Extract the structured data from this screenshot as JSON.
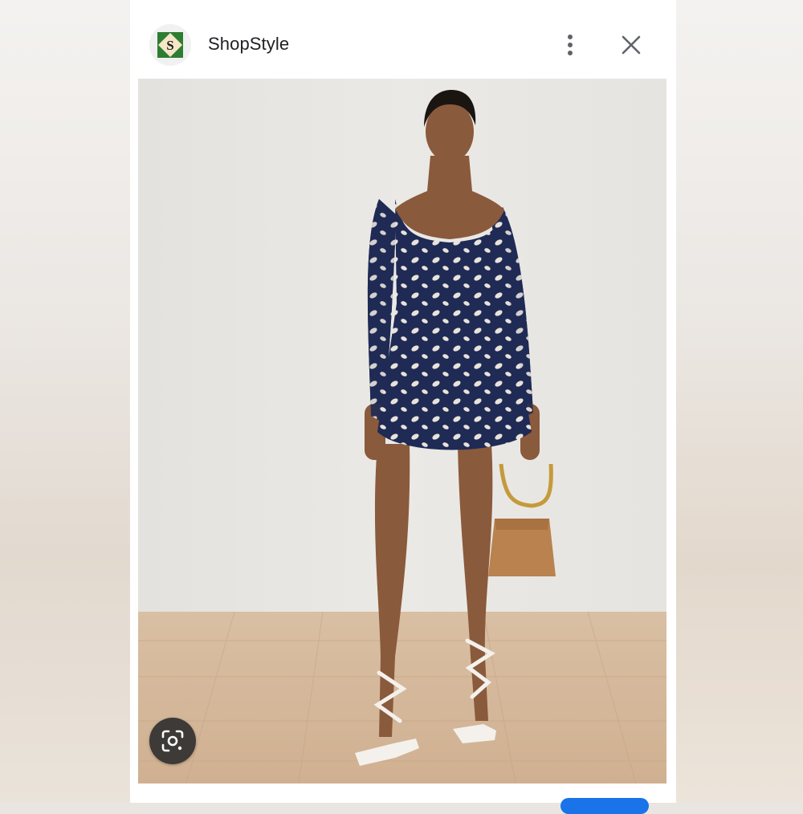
{
  "header": {
    "site_name": "ShopStyle",
    "logo_letter": "S",
    "icons": {
      "logo": "shopstyle-logo-icon",
      "more": "more-vert-icon",
      "close": "close-icon"
    }
  },
  "image": {
    "icons": {
      "lens": "google-lens-icon"
    }
  },
  "colors": {
    "logo_green": "#2e7d32",
    "logo_accent": "#f5e6c8",
    "dress_navy": "#1f2a55",
    "bag_tan": "#b9824f",
    "floor_wood": "#d7b99a",
    "wall": "#e9e7e3",
    "accent_blue": "#1a73e8"
  }
}
